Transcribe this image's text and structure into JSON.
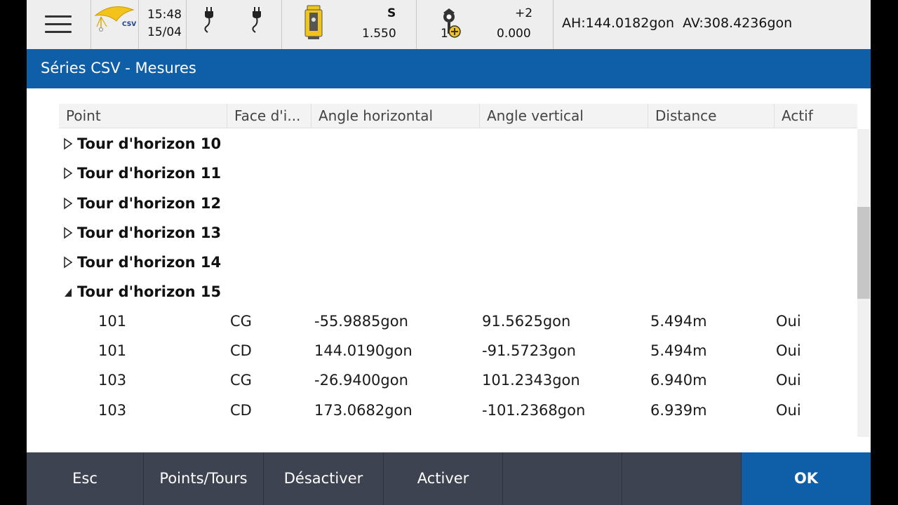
{
  "status_bar": {
    "logo_text": "CSV",
    "time": "15:48",
    "date": "15/04",
    "instrument": {
      "face": "S",
      "height": "1.550"
    },
    "target": {
      "number": "1",
      "prism_constant": "+2",
      "height": "0.000"
    },
    "angles": "AH:144.0182gon  AV:308.4236gon"
  },
  "title": "Séries CSV - Mesures",
  "table": {
    "columns": [
      "Point",
      "Face d'i...",
      "Angle horizontal",
      "Angle vertical",
      "Distance",
      "Actif"
    ],
    "groups": [
      {
        "label": "Tour d'horizon 10"
      },
      {
        "label": "Tour d'horizon 11"
      },
      {
        "label": "Tour d'horizon 12"
      },
      {
        "label": "Tour d'horizon 13"
      },
      {
        "label": "Tour d'horizon 14"
      },
      {
        "label": "Tour d'horizon 15"
      }
    ],
    "rows": [
      {
        "point": "101",
        "face": "CG",
        "ah": "-55.9885gon",
        "av": "91.5625gon",
        "dist": "5.494m",
        "actif": "Oui"
      },
      {
        "point": "101",
        "face": "CD",
        "ah": "144.0190gon",
        "av": "-91.5723gon",
        "dist": "5.494m",
        "actif": "Oui"
      },
      {
        "point": "103",
        "face": "CG",
        "ah": "-26.9400gon",
        "av": "101.2343gon",
        "dist": "6.940m",
        "actif": "Oui"
      },
      {
        "point": "103",
        "face": "CD",
        "ah": "173.0682gon",
        "av": "-101.2368gon",
        "dist": "6.939m",
        "actif": "Oui"
      }
    ]
  },
  "footer": {
    "esc": "Esc",
    "points_tours": "Points/Tours",
    "desactiver": "Désactiver",
    "activer": "Activer",
    "ok": "OK"
  },
  "colors": {
    "accent": "#0f5fa8",
    "footer_bg": "#3d4350",
    "statusbar_bg": "#eeeeee"
  }
}
